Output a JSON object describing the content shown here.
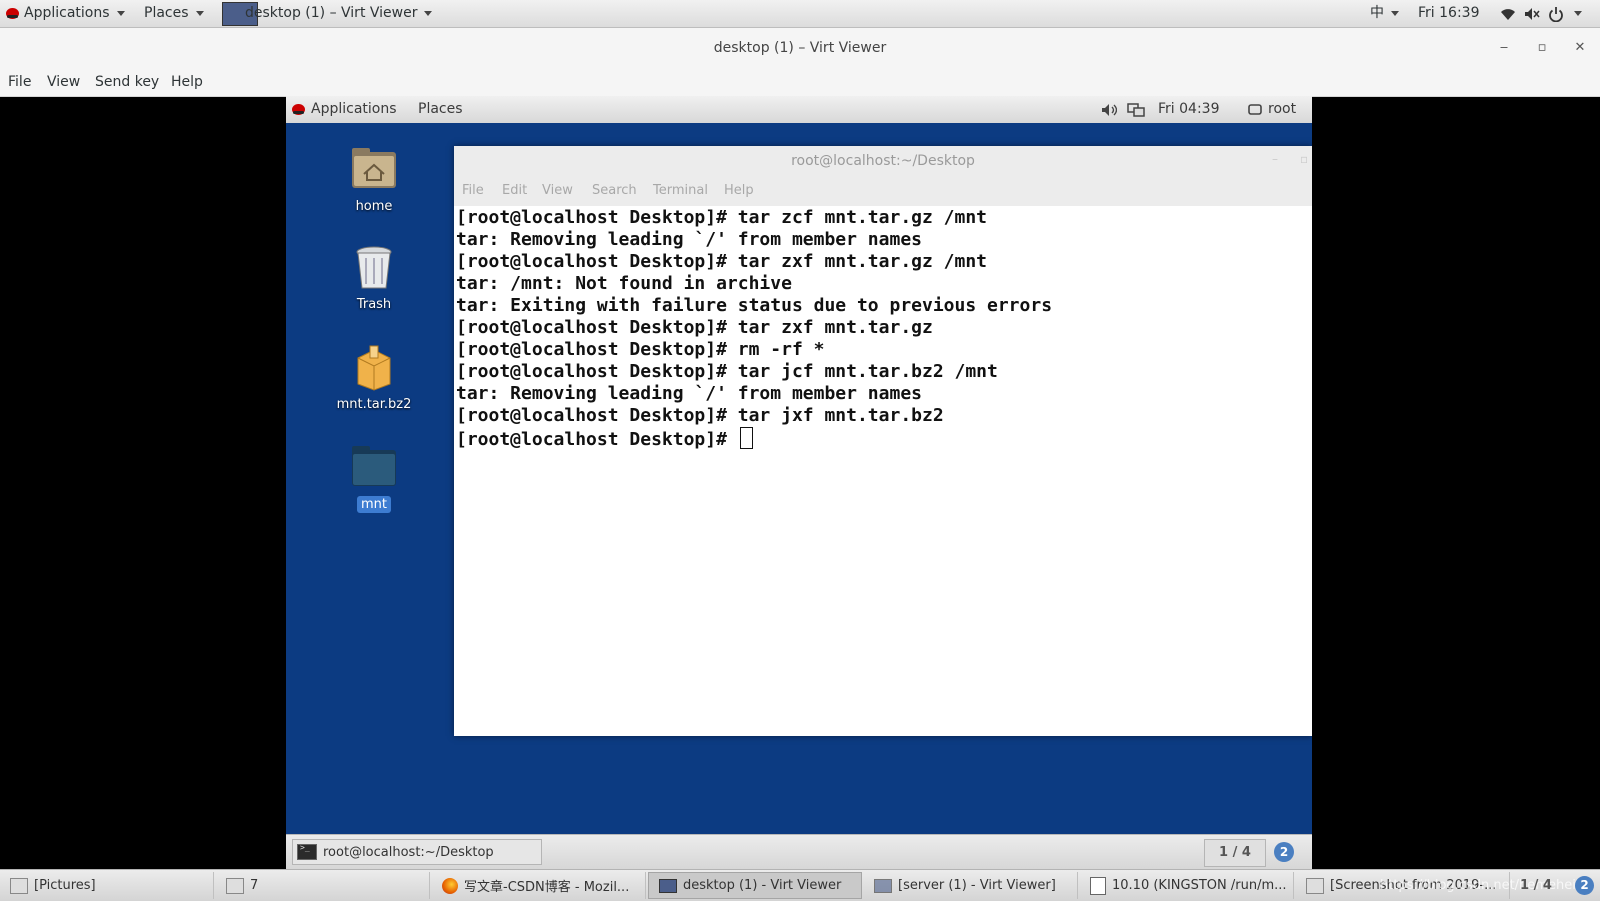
{
  "host_topbar": {
    "applications": "Applications",
    "places": "Places",
    "active_window": "desktop (1) – Virt Viewer",
    "input_method": "中",
    "clock": "Fri 16:39"
  },
  "virt_viewer": {
    "title": "desktop (1) – Virt Viewer",
    "menu": [
      "File",
      "View",
      "Send key",
      "Help"
    ]
  },
  "guest": {
    "topbar": {
      "applications": "Applications",
      "places": "Places",
      "clock": "Fri 04:39",
      "user": "root"
    },
    "desktop_icons": [
      "home",
      "Trash",
      "mnt.tar.bz2",
      "mnt"
    ],
    "terminal": {
      "title": "root@localhost:~/Desktop",
      "menu": [
        "File",
        "Edit",
        "View",
        "Search",
        "Terminal",
        "Help"
      ],
      "lines": [
        "[root@localhost Desktop]# tar zcf mnt.tar.gz /mnt",
        "tar: Removing leading `/' from member names",
        "[root@localhost Desktop]# tar zxf mnt.tar.gz /mnt",
        "tar: /mnt: Not found in archive",
        "tar: Exiting with failure status due to previous errors",
        "[root@localhost Desktop]# tar zxf mnt.tar.gz",
        "[root@localhost Desktop]# rm -rf *",
        "[root@localhost Desktop]# tar jcf mnt.tar.bz2 /mnt",
        "tar: Removing leading `/' from member names",
        "[root@localhost Desktop]# tar jxf mnt.tar.bz2",
        "[root@localhost Desktop]# "
      ]
    },
    "bottombar": {
      "task": "root@localhost:~/Desktop",
      "workspace": "1 / 4",
      "notifications": "2"
    }
  },
  "host_taskbar": {
    "tasks": [
      "[Pictures]",
      "7",
      "写文章-CSDN博客 - Mozil...",
      "desktop (1) - Virt Viewer",
      "[server (1) - Virt Viewer]",
      "10.10 (KINGSTON /run/m...",
      "[Screenshot from 2019-..."
    ],
    "workspace": "1 / 4",
    "notifications": "2",
    "watermark": "https://blog.csdn.net/hemehei"
  }
}
